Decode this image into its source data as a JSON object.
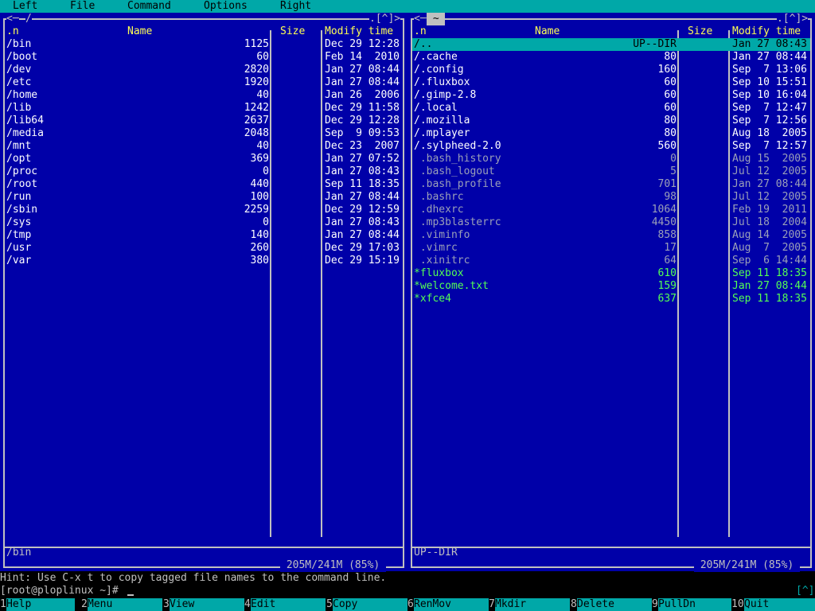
{
  "colors": {
    "panel_bg": "#0000a8",
    "text": "#c0c0c0",
    "header": "#ffff54",
    "directory": "#ffffff",
    "executable": "#54ff54",
    "hidden_file": "#9ba0b8",
    "cursor_bg": "#00a8a8",
    "menu_bg": "#00a8a8"
  },
  "menu": [
    "Left",
    "File",
    "Command",
    "Options",
    "Right"
  ],
  "left_panel": {
    "path_title": "/",
    "corner_left": "<─",
    "corner_right": ".[^]>",
    "columns": {
      "n": ".n",
      "name": "Name",
      "size": "Size",
      "mtime": "Modify time"
    },
    "rows": [
      {
        "name": "/bin",
        "size": "1125",
        "mtime": "Dec 29 12:28",
        "kind": "dir"
      },
      {
        "name": "/boot",
        "size": "60",
        "mtime": "Feb 14  2010",
        "kind": "dir"
      },
      {
        "name": "/dev",
        "size": "2820",
        "mtime": "Jan 27 08:44",
        "kind": "dir"
      },
      {
        "name": "/etc",
        "size": "1920",
        "mtime": "Jan 27 08:44",
        "kind": "dir"
      },
      {
        "name": "/home",
        "size": "40",
        "mtime": "Jan 26  2006",
        "kind": "dir"
      },
      {
        "name": "/lib",
        "size": "1242",
        "mtime": "Dec 29 11:58",
        "kind": "dir"
      },
      {
        "name": "/lib64",
        "size": "2637",
        "mtime": "Dec 29 12:28",
        "kind": "dir"
      },
      {
        "name": "/media",
        "size": "2048",
        "mtime": "Sep  9 09:53",
        "kind": "dir"
      },
      {
        "name": "/mnt",
        "size": "40",
        "mtime": "Dec 23  2007",
        "kind": "dir"
      },
      {
        "name": "/opt",
        "size": "369",
        "mtime": "Jan 27 07:52",
        "kind": "dir"
      },
      {
        "name": "/proc",
        "size": "0",
        "mtime": "Jan 27 08:43",
        "kind": "dir"
      },
      {
        "name": "/root",
        "size": "440",
        "mtime": "Sep 11 18:35",
        "kind": "dir"
      },
      {
        "name": "/run",
        "size": "100",
        "mtime": "Jan 27 08:44",
        "kind": "dir"
      },
      {
        "name": "/sbin",
        "size": "2259",
        "mtime": "Dec 29 12:59",
        "kind": "dir"
      },
      {
        "name": "/sys",
        "size": "0",
        "mtime": "Jan 27 08:43",
        "kind": "dir"
      },
      {
        "name": "/tmp",
        "size": "140",
        "mtime": "Jan 27 08:44",
        "kind": "dir"
      },
      {
        "name": "/usr",
        "size": "260",
        "mtime": "Dec 29 17:03",
        "kind": "dir"
      },
      {
        "name": "/var",
        "size": "380",
        "mtime": "Dec 29 15:19",
        "kind": "dir"
      }
    ],
    "mini_status": "/bin",
    "disk_info": " 205M/241M (85%) "
  },
  "right_panel": {
    "path_title": " ~ ",
    "corner_left": "<─",
    "corner_right": ".[^]>",
    "columns": {
      "n": ".n",
      "name": "Name",
      "size": "Size",
      "mtime": "Modify time"
    },
    "rows": [
      {
        "name": "/..",
        "size": "UP--DIR",
        "mtime": "Jan 27 08:43",
        "kind": "dir",
        "selected": true
      },
      {
        "name": "/.cache",
        "size": "80",
        "mtime": "Jan 27 08:44",
        "kind": "dir"
      },
      {
        "name": "/.config",
        "size": "160",
        "mtime": "Sep  7 13:06",
        "kind": "dir"
      },
      {
        "name": "/.fluxbox",
        "size": "60",
        "mtime": "Sep 10 15:51",
        "kind": "dir"
      },
      {
        "name": "/.gimp-2.8",
        "size": "60",
        "mtime": "Sep 10 16:04",
        "kind": "dir"
      },
      {
        "name": "/.local",
        "size": "60",
        "mtime": "Sep  7 12:47",
        "kind": "dir"
      },
      {
        "name": "/.mozilla",
        "size": "80",
        "mtime": "Sep  7 12:56",
        "kind": "dir"
      },
      {
        "name": "/.mplayer",
        "size": "80",
        "mtime": "Aug 18  2005",
        "kind": "dir"
      },
      {
        "name": "/.sylpheed-2.0",
        "size": "560",
        "mtime": "Sep  7 12:57",
        "kind": "dir"
      },
      {
        "name": " .bash_history",
        "size": "0",
        "mtime": "Aug 15  2005",
        "kind": "hidden"
      },
      {
        "name": " .bash_logout",
        "size": "5",
        "mtime": "Jul 12  2005",
        "kind": "hidden"
      },
      {
        "name": " .bash_profile",
        "size": "701",
        "mtime": "Jan 27 08:44",
        "kind": "hidden"
      },
      {
        "name": " .bashrc",
        "size": "98",
        "mtime": "Jul 12  2005",
        "kind": "hidden"
      },
      {
        "name": " .dhexrc",
        "size": "1064",
        "mtime": "Feb 19  2011",
        "kind": "hidden"
      },
      {
        "name": " .mp3blasterrc",
        "size": "4450",
        "mtime": "Jul 18  2004",
        "kind": "hidden"
      },
      {
        "name": " .viminfo",
        "size": "858",
        "mtime": "Aug 14  2005",
        "kind": "hidden"
      },
      {
        "name": " .vimrc",
        "size": "17",
        "mtime": "Aug  7  2005",
        "kind": "hidden"
      },
      {
        "name": " .xinitrc",
        "size": "64",
        "mtime": "Sep  6 14:44",
        "kind": "hidden"
      },
      {
        "name": "*fluxbox",
        "size": "610",
        "mtime": "Sep 11 18:35",
        "kind": "exec"
      },
      {
        "name": "*welcome.txt",
        "size": "159",
        "mtime": "Jan 27 08:44",
        "kind": "exec"
      },
      {
        "name": "*xfce4",
        "size": "637",
        "mtime": "Sep 11 18:35",
        "kind": "exec"
      }
    ],
    "mini_status": "UP--DIR",
    "disk_info": " 205M/241M (85%) "
  },
  "hint": "Hint: Use C-x t to copy tagged file names to the command line.",
  "command_line": "[root@ploplinux ~]# ",
  "cmd_indicator": "[^]",
  "fkeys": [
    {
      "num": "1",
      "label": "Help"
    },
    {
      "num": "2",
      "label": "Menu"
    },
    {
      "num": "3",
      "label": "View"
    },
    {
      "num": "4",
      "label": "Edit"
    },
    {
      "num": "5",
      "label": "Copy"
    },
    {
      "num": "6",
      "label": "RenMov"
    },
    {
      "num": "7",
      "label": "Mkdir"
    },
    {
      "num": "8",
      "label": "Delete"
    },
    {
      "num": "9",
      "label": "PullDn"
    },
    {
      "num": "10",
      "label": "Quit"
    }
  ]
}
